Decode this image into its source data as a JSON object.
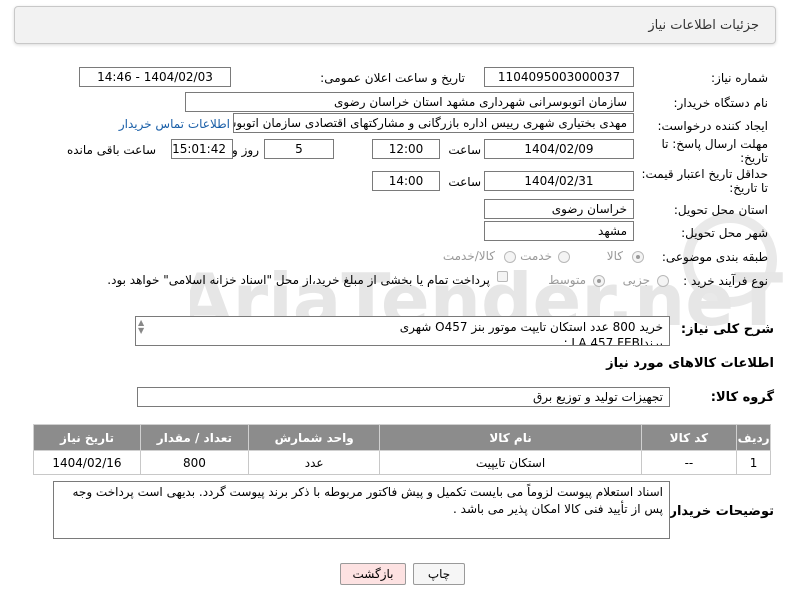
{
  "header": {
    "title": "جزئیات اطلاعات نیاز"
  },
  "form": {
    "need_number": {
      "label": "شماره نیاز:",
      "value": "1104095003000037"
    },
    "announce_datetime": {
      "label": "تاریخ و ساعت اعلان عمومی:",
      "value": "1404/02/03 - 14:46"
    },
    "buyer_org": {
      "label": "نام دستگاه خریدار:",
      "value": "سازمان اتوبوسرانی شهرداری مشهد استان خراسان رضوی"
    },
    "requester": {
      "label": "ایجاد کننده درخواست:",
      "value": "مهدی بختیاری شهری رییس اداره بازرگانی و مشارکتهای اقتصادی سازمان اتوبوسرانی",
      "contact_link": "اطلاعات تماس خریدار"
    },
    "reply_deadline": {
      "label_line1": "مهلت ارسال پاسخ: تا",
      "label_line2": "تاریخ:",
      "date": "1404/02/09",
      "time_label": "ساعت",
      "time": "12:00",
      "days": "5",
      "days_label": "روز و",
      "remaining": "15:01:42",
      "remaining_label": "ساعت باقی مانده"
    },
    "price_validity": {
      "label_line1": "حداقل تاریخ اعتبار قیمت:",
      "label_line2": "تا تاریخ:",
      "date": "1404/02/31",
      "time_label": "ساعت",
      "time": "14:00"
    },
    "delivery_province": {
      "label": "استان محل تحویل:",
      "value": "خراسان رضوی"
    },
    "delivery_city": {
      "label": "شهر محل تحویل:",
      "value": "مشهد"
    },
    "category": {
      "label": "طبقه بندی موضوعی:",
      "options": [
        "کالا",
        "خدمت",
        "کالا/خدمت"
      ],
      "selected": "کالا"
    },
    "purchase_type": {
      "label": "نوع فرآیند خرید :",
      "options": [
        "جزیی",
        "متوسط"
      ],
      "selected": "متوسط",
      "payment_note": "پرداخت تمام یا بخشی از مبلغ خرید،از محل \"اسناد خزانه اسلامی\" خواهد بود."
    }
  },
  "description": {
    "label": "شرح کلی نیاز:",
    "line1": "خرید 800 عدد استکان تایپت موتور بنز O457 شهری",
    "line2": "برندLA  457  FEBI  :"
  },
  "goods_info": {
    "title": "اطلاعات کالاهای مورد نیاز",
    "group_label": "گروه کالا:",
    "group_value": "تجهیزات تولید و توزیع برق"
  },
  "table": {
    "headers": [
      "ردیف",
      "کد کالا",
      "نام کالا",
      "واحد شمارش",
      "تعداد / مقدار",
      "تاریخ نیاز"
    ],
    "rows": [
      {
        "row": "1",
        "code": "--",
        "name": "استکان تایپیت",
        "unit": "عدد",
        "qty": "800",
        "date": "1404/02/16"
      }
    ]
  },
  "buyer_notes": {
    "label": "توضیحات خریدار:",
    "text": "اسناد استعلام پیوست لزوماً می بایست تکمیل و پیش فاکتور مربوطه با ذکر برند پیوست گردد. بدیهی است پرداخت وجه پس از تأیید فنی کالا امکان پذیر می باشد ."
  },
  "buttons": {
    "print": "چاپ",
    "back": "بازگشت"
  },
  "watermark_text": "AriaTender.neT",
  "colors": {
    "back_button_bg": "#fde2e2",
    "table_header_bg": "#8c8c8c",
    "link": "#1a5fa8"
  }
}
